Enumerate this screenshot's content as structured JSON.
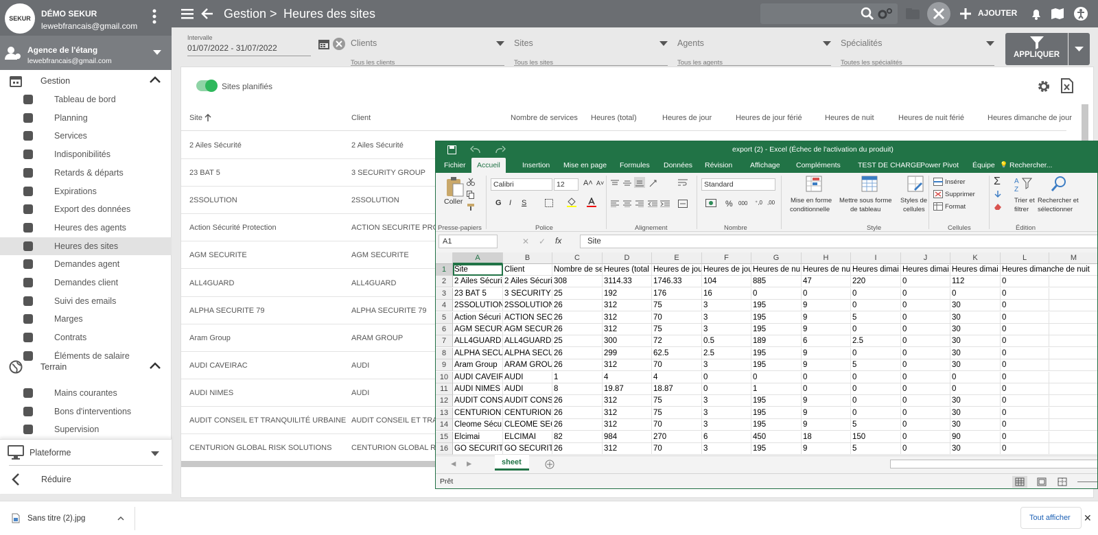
{
  "app": {
    "org_name": "DÉMO SEKUR",
    "user_email": "lewebfrancais@gmail.com",
    "logo_text": "SEKUR",
    "agency_name": "Agence de l'étang",
    "agency_email": "lewebfrancais@gmail.com"
  },
  "header": {
    "breadcrumb_root": "Gestion",
    "breadcrumb_sep": ">",
    "page_title": "Heures des sites",
    "add_label": "AJOUTER"
  },
  "sidebar": {
    "gestion_label": "Gestion",
    "gestion_items": [
      {
        "label": "Tableau de bord",
        "icon": "dashboard-icon"
      },
      {
        "label": "Planning",
        "icon": "calendar-icon"
      },
      {
        "label": "Services",
        "icon": "clipboard-icon"
      },
      {
        "label": "Indisponibilités",
        "icon": "user-off-icon"
      },
      {
        "label": "Retards & départs",
        "icon": "stopwatch-icon"
      },
      {
        "label": "Expirations",
        "icon": "hourglass-icon"
      },
      {
        "label": "Export des données",
        "icon": "cloud-download-icon"
      },
      {
        "label": "Heures des agents",
        "icon": "user-clock-icon"
      },
      {
        "label": "Heures des sites",
        "icon": "user-clock-icon"
      },
      {
        "label": "Demandes agent",
        "icon": "chat-icon"
      },
      {
        "label": "Demandes client",
        "icon": "chat-icon"
      },
      {
        "label": "Suivi des emails",
        "icon": "mail-icon"
      },
      {
        "label": "Marges",
        "icon": "pie-chart-icon"
      },
      {
        "label": "Contrats",
        "icon": "contract-icon"
      },
      {
        "label": "Éléments de salaire",
        "icon": "salary-icon"
      }
    ],
    "terrain_label": "Terrain",
    "terrain_items": [
      {
        "label": "Mains courantes",
        "icon": "pen-icon"
      },
      {
        "label": "Bons d'interventions",
        "icon": "checklist-icon"
      },
      {
        "label": "Supervision",
        "icon": "globe-icon"
      }
    ],
    "plateforme_label": "Plateforme",
    "reduce_label": "Réduire"
  },
  "filters": {
    "interval_label": "Intervalle",
    "interval_value": "01/07/2022 - 31/07/2022",
    "clients_label": "Clients",
    "clients_sub": "Tous les clients",
    "sites_label": "Sites",
    "sites_sub": "Tous les sites",
    "agents_label": "Agents",
    "agents_sub": "Tous les agents",
    "specialites_label": "Spécialités",
    "specialites_sub": "Toutes les spécialités",
    "apply_label": "APPLIQUER"
  },
  "table": {
    "toggle_label": "Sites planifiés",
    "headers": {
      "site": "Site",
      "client": "Client",
      "services": "Nombre de services",
      "total": "Heures (total)",
      "jour": "Heures de jour",
      "jour_ferie": "Heures de jour férié",
      "nuit": "Heures de nuit",
      "nuit_ferie": "Heures de nuit férié",
      "dimanche_jour": "Heures dimanche de jour"
    },
    "rows": [
      {
        "site": "2 Ailes Sécurité",
        "client": "2 Ailes Sécurité"
      },
      {
        "site": "23 BAT 5",
        "client": "3 SECURITY GROUP"
      },
      {
        "site": "2SSOLUTION",
        "client": "2SSOLUTION"
      },
      {
        "site": "Action Sécurité Protection",
        "client": "ACTION SECURITE PROTECTION"
      },
      {
        "site": "AGM SECURITE",
        "client": "AGM SECURITE"
      },
      {
        "site": "ALL4GUARD",
        "client": "ALL4GUARD"
      },
      {
        "site": "ALPHA SECURITE 79",
        "client": "ALPHA SECURITE 79"
      },
      {
        "site": "Aram Group",
        "client": "ARAM GROUP"
      },
      {
        "site": "AUDI CAVEIRAC",
        "client": "AUDI"
      },
      {
        "site": "AUDI NIMES",
        "client": "AUDI"
      },
      {
        "site": "AUDIT CONSEIL ET TRANQUILITÉ URBAINE",
        "client": "AUDIT CONSEIL ET TRANQUILITÉ URBAINE"
      },
      {
        "site": "CENTURION GLOBAL RISK SOLUTIONS",
        "client": "CENTURION GLOBAL RISK SOLUTIONS"
      }
    ]
  },
  "excel": {
    "title": "export (2) - Excel (Échec de l'activation du produit)",
    "tabs": [
      "Fichier",
      "Accueil",
      "Insertion",
      "Mise en page",
      "Formules",
      "Données",
      "Révision",
      "Affichage",
      "Compléments",
      "TEST DE CHARGE",
      "Power Pivot",
      "Équipe"
    ],
    "search_label": "Rechercher...",
    "ribbon": {
      "paste_label": "Coller",
      "clipboard_group": "Presse-papiers",
      "font_name": "Calibri",
      "font_size": "12",
      "bold": "G",
      "italic": "I",
      "underline": "S",
      "font_group": "Police",
      "align_group": "Alignement",
      "number_format": "Standard",
      "number_group": "Nombre",
      "cond_format_1": "Mise en forme",
      "cond_format_2": "conditionnelle",
      "table_format_1": "Mettre sous forme",
      "table_format_2": "de tableau",
      "cell_styles_1": "Styles de",
      "cell_styles_2": "cellules",
      "style_group": "Style",
      "insert_label": "Insérer",
      "delete_label": "Supprimer",
      "format_label": "Format",
      "cells_group": "Cellules",
      "sort_1": "Trier et",
      "sort_2": "filtrer",
      "find_1": "Rechercher et",
      "find_2": "sélectionner",
      "edit_group": "Édition"
    },
    "name_box": "A1",
    "formula": "Site",
    "columns": [
      "A",
      "B",
      "C",
      "D",
      "E",
      "F",
      "G",
      "H",
      "I",
      "J",
      "K",
      "L",
      "M"
    ],
    "grid": [
      [
        "Site",
        "Client",
        "Nombre de se",
        "Heures (total",
        "Heures de jou",
        "Heures de jou",
        "Heures de nu",
        "Heures de nu",
        "Heures dimai",
        "Heures dimai",
        "Heures dimai",
        "Heures dimanche de nuit",
        ""
      ],
      [
        "2 Ailes Sécuri",
        "2 Ailes Sécuri",
        "308",
        "3114.33",
        "1746.33",
        "104",
        "885",
        "47",
        "220",
        "0",
        "112",
        "0",
        ""
      ],
      [
        "23 BAT 5",
        "3 SECURITY G",
        "25",
        "192",
        "176",
        "16",
        "0",
        "0",
        "0",
        "0",
        "0",
        "0",
        ""
      ],
      [
        "2SSOLUTION",
        "2SSOLUTION",
        "26",
        "312",
        "75",
        "3",
        "195",
        "9",
        "0",
        "0",
        "30",
        "0",
        ""
      ],
      [
        "Action Sécuri",
        "ACTION SECU",
        "26",
        "312",
        "70",
        "3",
        "195",
        "9",
        "5",
        "0",
        "30",
        "0",
        ""
      ],
      [
        "AGM SECURIT",
        "AGM SECURIT",
        "26",
        "312",
        "75",
        "3",
        "195",
        "9",
        "0",
        "0",
        "30",
        "0",
        ""
      ],
      [
        "ALL4GUARD",
        "ALL4GUARD",
        "25",
        "300",
        "72",
        "0.5",
        "189",
        "6",
        "2.5",
        "0",
        "30",
        "0",
        ""
      ],
      [
        "ALPHA SECUI",
        "ALPHA SECUR",
        "26",
        "299",
        "62.5",
        "2.5",
        "195",
        "9",
        "0",
        "0",
        "30",
        "0",
        ""
      ],
      [
        "Aram Group",
        "ARAM GROU",
        "26",
        "312",
        "70",
        "3",
        "195",
        "9",
        "5",
        "0",
        "30",
        "0",
        ""
      ],
      [
        "AUDI CAVEIR",
        "AUDI",
        "1",
        "4",
        "4",
        "0",
        "0",
        "0",
        "0",
        "0",
        "0",
        "0",
        ""
      ],
      [
        "AUDI NIMES",
        "AUDI",
        "8",
        "19.87",
        "18.87",
        "0",
        "1",
        "0",
        "0",
        "0",
        "0",
        "0",
        ""
      ],
      [
        "AUDIT CONSI",
        "AUDIT CONSE",
        "26",
        "312",
        "75",
        "3",
        "195",
        "9",
        "0",
        "0",
        "30",
        "0",
        ""
      ],
      [
        "CENTURION (",
        "CENTURION (",
        "26",
        "312",
        "75",
        "3",
        "195",
        "9",
        "0",
        "0",
        "30",
        "0",
        ""
      ],
      [
        "Cleome Sécu",
        "CLEOME SEC",
        "26",
        "312",
        "70",
        "3",
        "195",
        "9",
        "5",
        "0",
        "30",
        "0",
        ""
      ],
      [
        "Elcimai",
        "ELCIMAI",
        "82",
        "984",
        "270",
        "6",
        "450",
        "18",
        "150",
        "0",
        "90",
        "0",
        ""
      ],
      [
        "GO SECURITE",
        "GO SECURITE",
        "26",
        "312",
        "70",
        "3",
        "195",
        "9",
        "5",
        "0",
        "30",
        "0",
        ""
      ]
    ],
    "sheet_tab": "sheet",
    "status": "Prêt"
  },
  "download": {
    "file_name": "Sans titre (2).jpg",
    "show_all": "Tout afficher"
  },
  "colors": {
    "topbar": "#6b6e72",
    "excel_green": "#217346",
    "toggle_green": "#2eb85c"
  }
}
